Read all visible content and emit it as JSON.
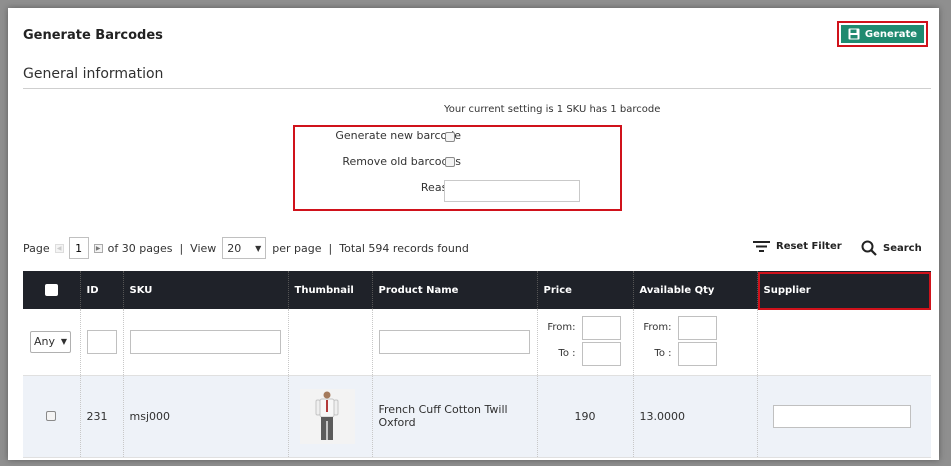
{
  "page": {
    "title": "Generate Barcodes",
    "generate_label": "Generate",
    "accent_color": "#1f8a70",
    "highlight_color": "#d0121b"
  },
  "general": {
    "section_title": "General information",
    "setting_note": "Your current setting is 1 SKU has 1 barcode",
    "generate_new_label": "Generate new barcode",
    "remove_old_label": "Remove old barcodes",
    "reason_label": "Reason",
    "reason_value": ""
  },
  "pager": {
    "page_label": "Page",
    "current_page": "1",
    "of_pages": "of 30 pages",
    "separator": "|",
    "view_label": "View",
    "per_page_value": "20",
    "per_page_label": "per page",
    "total": "Total 594 records found",
    "reset_filter": "Reset Filter",
    "search": "Search"
  },
  "grid": {
    "columns": [
      "ID",
      "SKU",
      "Thumbnail",
      "Product Name",
      "Price",
      "Available Qty",
      "Supplier"
    ],
    "filters": {
      "any_option": "Any",
      "from_label": "From:",
      "to_label": "To :"
    },
    "rows": [
      {
        "id": "231",
        "sku": "msj000",
        "thumbnail_icon": "product-thumbnail-icon",
        "product_name": "French Cuff Cotton Twill Oxford",
        "price": "190",
        "available_qty": "13.0000",
        "supplier": ""
      }
    ]
  }
}
